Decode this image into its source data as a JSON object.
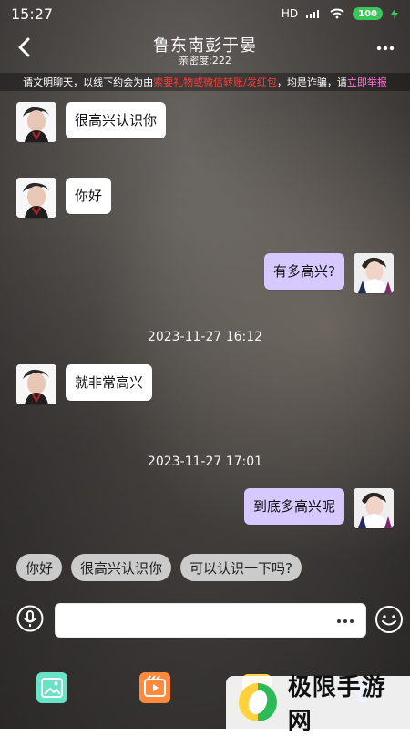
{
  "status": {
    "time": "15:27",
    "network": "HD",
    "battery": "100"
  },
  "header": {
    "title": "鲁东南彭于晏",
    "subtitle": "亲密度:222"
  },
  "warning": {
    "prefix": "请文明聊天，以线下约会为由",
    "red": "索要礼物或微信转账/发红包",
    "middle": "，均是诈骗，请",
    "pink": "立即举报"
  },
  "messages": [
    {
      "side": "left",
      "text": "很高兴认识你",
      "avatar_icon": "male-avatar"
    },
    {
      "side": "left",
      "text": "你好",
      "avatar_icon": "male-avatar"
    },
    {
      "side": "right",
      "text": "有多高兴?",
      "avatar_icon": "female-avatar"
    },
    {
      "type": "timestamp",
      "text": "2023-11-27 16:12"
    },
    {
      "side": "left",
      "text": "就非常高兴",
      "avatar_icon": "male-avatar"
    },
    {
      "type": "timestamp",
      "text": "2023-11-27 17:01"
    },
    {
      "side": "right",
      "text": "到底多高兴呢",
      "avatar_icon": "female-avatar"
    }
  ],
  "quick_replies": [
    "你好",
    "很高兴认识你",
    "可以认识一下吗?"
  ],
  "composer": {
    "placeholder": "",
    "value": ""
  },
  "toolbar": {
    "photo_icon": "photo-icon",
    "video_icon": "video-icon",
    "gift_icon": "gift-icon",
    "more_icon": "more-tools-icon"
  },
  "watermark": {
    "text": "极限手游网"
  },
  "colors": {
    "self_bubble": "#d7c9ff",
    "warning_red": "#ff3a3a",
    "warning_pink": "#ff77d6",
    "watermark_bg": "#ffffff"
  }
}
